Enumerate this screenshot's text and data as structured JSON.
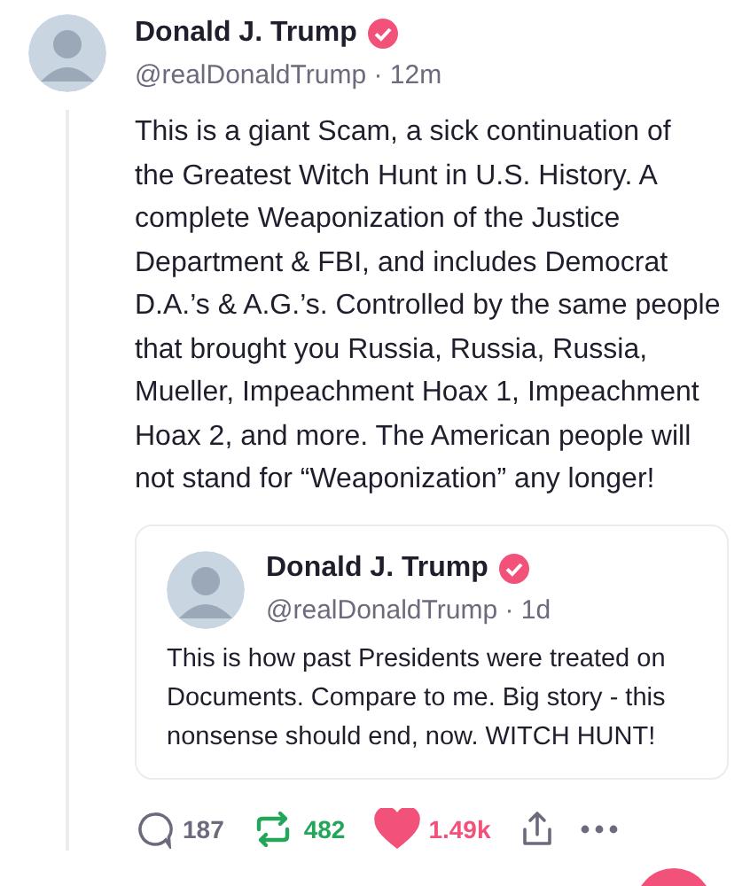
{
  "post": {
    "author": {
      "name": "Donald J. Trump",
      "verified": true,
      "handle": "@realDonaldTrump · 12m"
    },
    "text": "This is a giant Scam, a sick continuation of\nthe Greatest Witch Hunt in U.S. History. A\ncomplete Weaponization of the Justice\nDepartment & FBI, and includes Democrat\nD.A.’s & A.G.’s. Controlled by the same people\nthat brought you Russia, Russia, Russia,\nMueller, Impeachment Hoax 1, Impeachment\nHoax 2, and more. The American people will\nnot stand for “Weaponization” any longer!",
    "quoted": {
      "author": {
        "name": "Donald J. Trump",
        "verified": true,
        "handle": "@realDonaldTrump · 1d"
      },
      "text": "This is how past Presidents were treated on\nDocuments. Compare to me. Big story - this\nnonsense should end, now. WITCH HUNT!"
    },
    "actions": {
      "replies": "187",
      "reposts": "482",
      "reposted": true,
      "likes": "1.49k",
      "liked": true
    }
  }
}
